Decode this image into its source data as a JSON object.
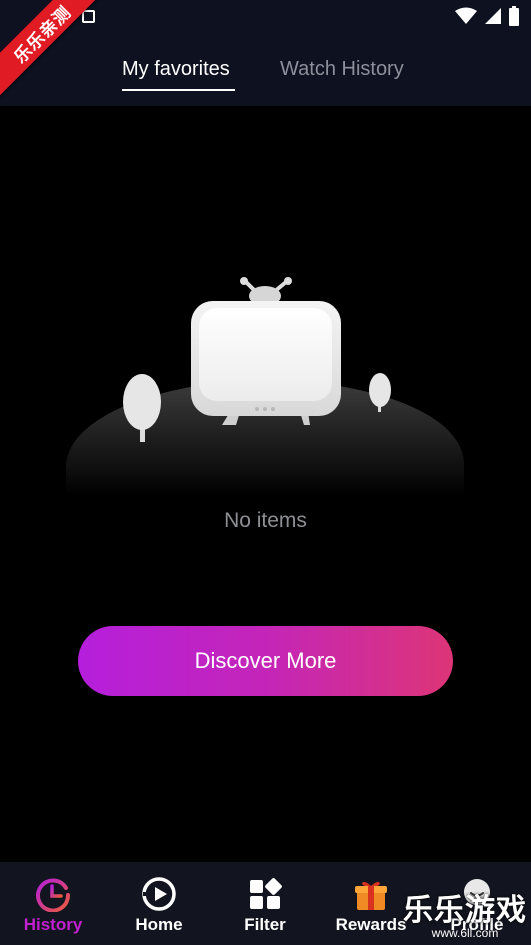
{
  "status_bar": {
    "icons": [
      "sim-card-icon",
      "wifi-icon",
      "signal-icon",
      "battery-icon"
    ]
  },
  "ribbon": {
    "text": "乐乐亲测"
  },
  "tabs": [
    {
      "label": "My favorites",
      "active": true
    },
    {
      "label": "Watch History",
      "active": false
    }
  ],
  "empty_state": {
    "message": "No items",
    "button_label": "Discover More"
  },
  "bottom_nav": [
    {
      "label": "History",
      "icon": "history-clock-icon",
      "active": true
    },
    {
      "label": "Home",
      "icon": "play-circle-icon",
      "active": false
    },
    {
      "label": "Filter",
      "icon": "grid-filter-icon",
      "active": false
    },
    {
      "label": "Rewards",
      "icon": "gift-box-icon",
      "active": false
    },
    {
      "label": "Profile",
      "icon": "profile-avatar-icon",
      "active": false
    }
  ],
  "watermark": {
    "main": "乐乐游戏",
    "sub": "www.6ll.com"
  },
  "colors": {
    "accent": "#c21fd0",
    "button_gradient_start": "#b51fdc",
    "button_gradient_end": "#dd3577",
    "header_bg": "#0d1120",
    "nav_bg": "#12151f"
  }
}
